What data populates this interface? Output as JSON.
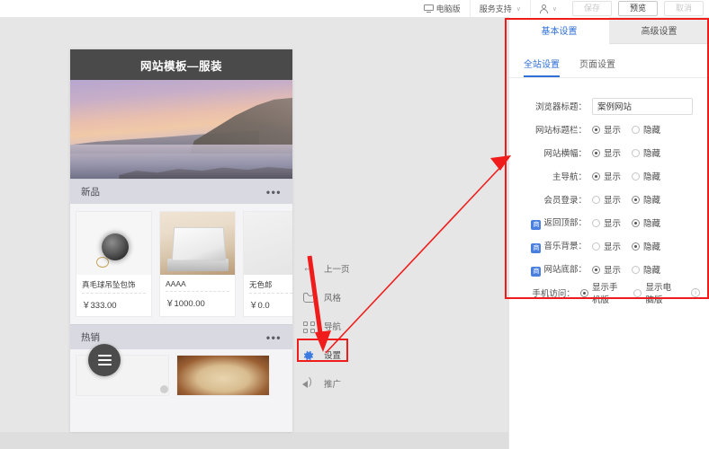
{
  "toolbar": {
    "device_label": "电脑版",
    "support_label": "服务支持",
    "account_label": "",
    "caret": "∨",
    "save_label": "保存",
    "preview_label": "预览",
    "cancel_label": "取消"
  },
  "preview": {
    "site_title": "网站模板—服装",
    "sections": [
      {
        "title": "新品",
        "menu_dots": "•••",
        "products": [
          {
            "name": "真毛球吊坠包饰",
            "price": "￥333.00"
          },
          {
            "name": "AAAA",
            "price": "￥1000.00"
          },
          {
            "name": "无色郎",
            "price": "￥0.0"
          }
        ]
      },
      {
        "title": "热销",
        "menu_dots": "•••"
      }
    ]
  },
  "side_menu": {
    "items": [
      {
        "label": "上一页",
        "icon": "back-arrow-icon",
        "active": false
      },
      {
        "label": "风格",
        "icon": "shirt-icon",
        "active": false
      },
      {
        "label": "导航",
        "icon": "grid-icon",
        "active": false
      },
      {
        "label": "设置",
        "icon": "gear-icon",
        "active": true
      },
      {
        "label": "推广",
        "icon": "megaphone-icon",
        "active": false
      }
    ]
  },
  "panel": {
    "tabs": [
      {
        "label": "基本设置",
        "active": true
      },
      {
        "label": "高级设置",
        "active": false
      }
    ],
    "sub_tabs": [
      {
        "label": "全站设置",
        "active": true
      },
      {
        "label": "页面设置",
        "active": false
      }
    ],
    "fields": [
      {
        "label": "浏览器标题：",
        "type": "text",
        "value": "案例网站",
        "badge": ""
      },
      {
        "label": "网站标题栏：",
        "type": "radio",
        "badge": "",
        "options": [
          {
            "label": "显示",
            "selected": true
          },
          {
            "label": "隐藏",
            "selected": false
          }
        ]
      },
      {
        "label": "网站横幅：",
        "type": "radio",
        "badge": "",
        "options": [
          {
            "label": "显示",
            "selected": true
          },
          {
            "label": "隐藏",
            "selected": false
          }
        ]
      },
      {
        "label": "主导航：",
        "type": "radio",
        "badge": "",
        "options": [
          {
            "label": "显示",
            "selected": true
          },
          {
            "label": "隐藏",
            "selected": false
          }
        ]
      },
      {
        "label": "会员登录：",
        "type": "radio",
        "badge": "",
        "options": [
          {
            "label": "显示",
            "selected": false
          },
          {
            "label": "隐藏",
            "selected": true
          }
        ]
      },
      {
        "label": "返回顶部：",
        "type": "radio",
        "badge": "商",
        "options": [
          {
            "label": "显示",
            "selected": false
          },
          {
            "label": "隐藏",
            "selected": true
          }
        ]
      },
      {
        "label": "音乐背景：",
        "type": "radio",
        "badge": "商",
        "options": [
          {
            "label": "显示",
            "selected": false
          },
          {
            "label": "隐藏",
            "selected": true
          }
        ]
      },
      {
        "label": "网站底部：",
        "type": "radio",
        "badge": "商",
        "options": [
          {
            "label": "显示",
            "selected": true
          },
          {
            "label": "隐藏",
            "selected": false
          }
        ]
      },
      {
        "label": "手机访问：",
        "type": "radio-info",
        "badge": "",
        "info": "i",
        "options": [
          {
            "label": "显示手机版",
            "selected": true
          },
          {
            "label": "显示电脑版",
            "selected": false
          }
        ]
      }
    ]
  },
  "colors": {
    "accent": "#2f6fd8",
    "annotation_red": "#f01c1c",
    "badge_blue": "#4a7fe0",
    "canvas_bg": "#e6e6e6",
    "header_dark": "#4a4a4a"
  }
}
